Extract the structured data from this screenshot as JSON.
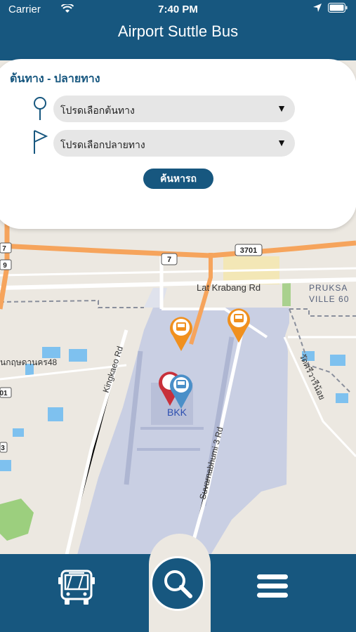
{
  "status_bar": {
    "carrier": "Carrier",
    "time": "7:40 PM"
  },
  "nav": {
    "title": "Airport Suttle Bus"
  },
  "route_panel": {
    "title": "ต้นทาง - ปลายทาง",
    "origin_value": "โปรดเลือกต้นทาง",
    "destination_value": "โปรดเลือกปลายทาง",
    "caret": "▼",
    "search_label": "ค้นหารถ"
  },
  "map": {
    "road_labels": {
      "lat_krabang": "Lat Krabang Rd",
      "kingkaeo": "Kingkaeo Rd",
      "suvarnabhumi": "Suvarnabhumi 3 Rd",
      "pruksa_1": "PRUKSA",
      "pruksa_2": "VILLE 60",
      "thai_road_left": "นกฤษดานคร48",
      "thai_road_right": "วัดศรีวารีน้อย",
      "shield_3701": "3701",
      "shield_7a": "7",
      "shield_7b": "7",
      "shield_9": "9",
      "shield_01": "01",
      "shield_3": "3"
    },
    "airport_code": "BKK"
  },
  "tab_bar": {
    "bus_tab": "bus-icon",
    "search_tab": "search-icon",
    "menu_tab": "menu-icon"
  },
  "colors": {
    "primary": "#17577f",
    "marker_orange": "#f0901e",
    "marker_red": "#c8303a",
    "marker_blue": "#4a8fc8"
  }
}
